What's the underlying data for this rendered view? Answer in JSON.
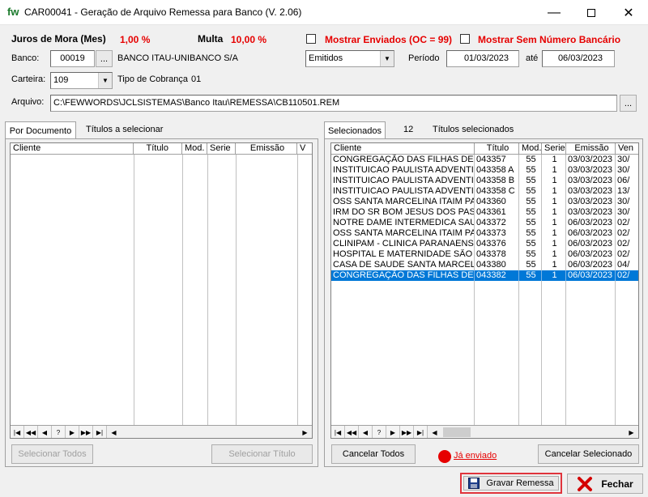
{
  "window": {
    "logo": "fw",
    "title": "CAR00041 - Geração de Arquivo Remessa para Banco   (V. 2.06)",
    "min_icon": "minimize-icon",
    "max_icon": "maximize-icon",
    "close_icon": "close-icon"
  },
  "header": {
    "juros_label": "Juros de Mora (Mes)",
    "juros_value": "1,00 %",
    "multa_label": "Multa",
    "multa_value": "10,00 %",
    "mostrar_enviados": "Mostrar Enviados (OC = 99)",
    "mostrar_sem_numero": "Mostrar Sem Número Bancário",
    "banco_label": "Banco:",
    "banco_code": "00019",
    "banco_lookup": "...",
    "banco_name": "BANCO ITAU-UNIBANCO S/A",
    "status_select": "Emitidos",
    "periodo_label": "Período",
    "periodo_from": "01/03/2023",
    "ate_label": "até",
    "periodo_to": "06/03/2023",
    "carteira_label": "Carteira:",
    "carteira_value": "109",
    "tipo_cobranca_label": "Tipo de Cobrança",
    "tipo_cobranca_value": "01",
    "arquivo_label": "Arquivo:",
    "arquivo_value": "C:\\FEWWORDS\\JCLSISTEMAS\\Banco Itau\\REMESSA\\CB110501.REM",
    "arquivo_browse": "..."
  },
  "left_panel": {
    "tab_active": "Por Documento",
    "tab_title": "Títulos a selecionar",
    "columns": [
      "Cliente",
      "Título",
      "Mod.",
      "Serie",
      "Emissão",
      "V"
    ],
    "nav": [
      "|◀",
      "◀◀",
      "◀",
      "?",
      "▶",
      "▶▶",
      "▶|"
    ],
    "btn_select_all": "Selecionar Todos",
    "btn_select_one": "Selecionar Título"
  },
  "right_panel": {
    "tab_active": "Selecionados",
    "count": "12",
    "tab_title": "Títulos selecionados",
    "columns": [
      "Cliente",
      "Título",
      "Mod.",
      "Serie",
      "Emissão",
      "Ven"
    ],
    "rows": [
      [
        "CONGREGAÇÃO DAS FILHAS DE N",
        "043357",
        "55",
        "1",
        "03/03/2023",
        "30/"
      ],
      [
        "INSTITUICAO PAULISTA ADVENTI",
        "043358 A",
        "55",
        "1",
        "03/03/2023",
        "30/"
      ],
      [
        "INSTITUICAO PAULISTA ADVENTI",
        "043358 B",
        "55",
        "1",
        "03/03/2023",
        "06/"
      ],
      [
        "INSTITUICAO PAULISTA ADVENTI",
        "043358 C",
        "55",
        "1",
        "03/03/2023",
        "13/"
      ],
      [
        "OSS SANTA MARCELINA ITAIM PA",
        "043360",
        "55",
        "1",
        "03/03/2023",
        "30/"
      ],
      [
        "IRM DO SR BOM JESUS DOS PAS",
        "043361",
        "55",
        "1",
        "03/03/2023",
        "30/"
      ],
      [
        "NOTRE DAME INTERMEDICA SAU",
        "043372",
        "55",
        "1",
        "06/03/2023",
        "02/"
      ],
      [
        "OSS SANTA MARCELINA ITAIM PA",
        "043373",
        "55",
        "1",
        "06/03/2023",
        "02/"
      ],
      [
        "CLINIPAM - CLINICA PARANAENSE",
        "043376",
        "55",
        "1",
        "06/03/2023",
        "02/"
      ],
      [
        "HOSPITAL E MATERNIDADE SÃO",
        "043378",
        "55",
        "1",
        "06/03/2023",
        "02/"
      ],
      [
        "CASA DE SAUDE SANTA MARCEL",
        "043380",
        "55",
        "1",
        "06/03/2023",
        "04/"
      ],
      [
        "CONGREGAÇÃO DAS FILHAS DE N",
        "043382",
        "55",
        "1",
        "06/03/2023",
        "02/"
      ]
    ],
    "selected_row": 11,
    "nav": [
      "|◀",
      "◀◀",
      "◀",
      "?",
      "▶",
      "▶▶",
      "▶|"
    ],
    "btn_cancel_all": "Cancelar Todos",
    "ja_enviado": "Já enviado",
    "btn_cancel_selected": "Cancelar Selecionado"
  },
  "footer": {
    "btn_gravar": "Gravar Remessa",
    "btn_fechar": "Fechar"
  },
  "colors": {
    "accent_red": "#e60000",
    "selection_blue": "#0078d7",
    "highlight_border": "#e0343c"
  }
}
